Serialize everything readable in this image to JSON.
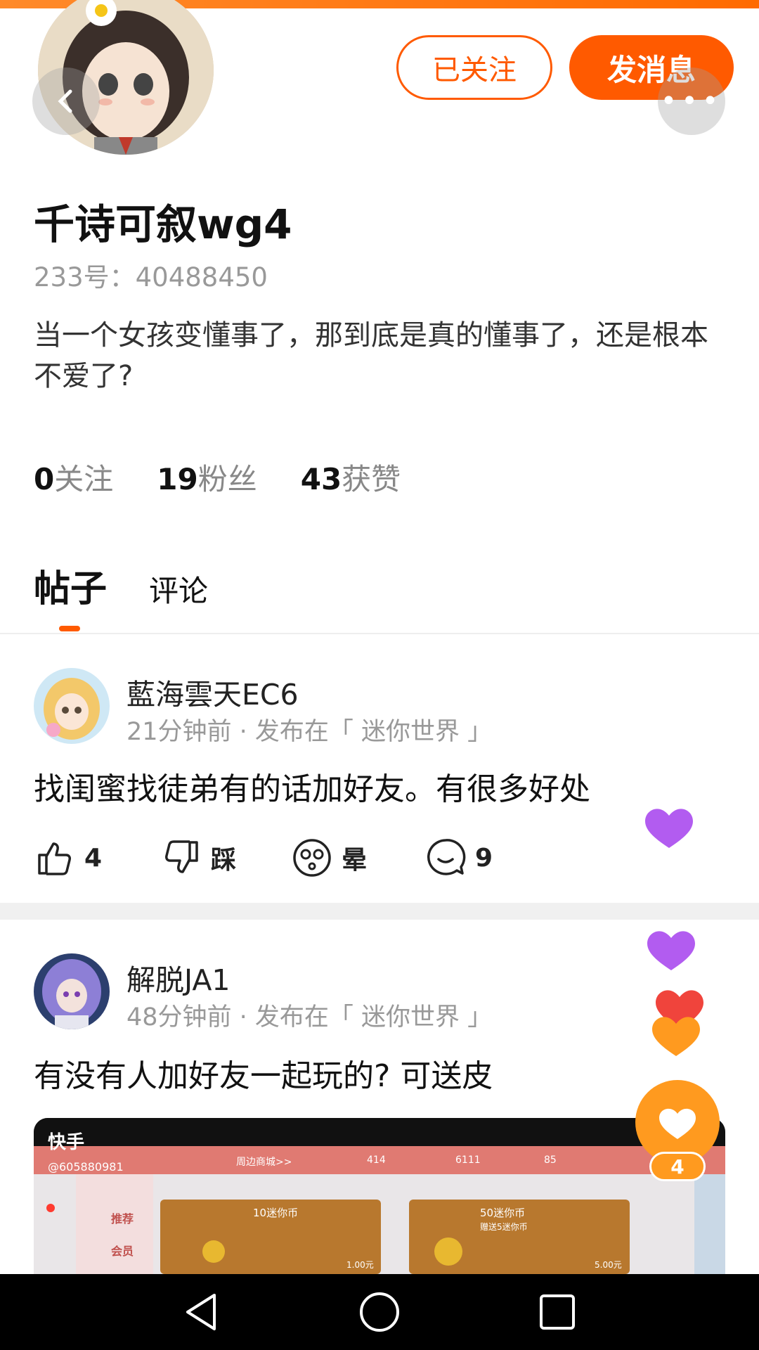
{
  "profile": {
    "name": "千诗可叙wg4",
    "id_text": "233号：40488450",
    "bio": "当一个女孩变懂事了，那到底是真的懂事了，还是根本不爱了?",
    "follow_button": "已关注",
    "message_button": "发消息",
    "stats": [
      {
        "num": "0",
        "label": "关注"
      },
      {
        "num": "19",
        "label": "粉丝"
      },
      {
        "num": "43",
        "label": "获赞"
      }
    ]
  },
  "tabs": [
    {
      "label": "帖子",
      "active": true
    },
    {
      "label": "评论",
      "active": false
    }
  ],
  "posts": [
    {
      "author": "藍海雲天EC6",
      "meta": "21分钟前 · 发布在「 迷你世界 」",
      "text": "找闺蜜找徒弟有的话加好友。有很多好处",
      "actions": {
        "like": "4",
        "dislike": "踩",
        "dizzy": "晕",
        "comment": "9"
      }
    },
    {
      "author": "解脱JA1",
      "meta": "48分钟前 · 发布在「 迷你世界 」",
      "text": "有没有人加好友一起玩的? 可送皮"
    }
  ],
  "video_preview": {
    "watermark_app": "快手",
    "watermark_id": "@605880981",
    "menu_items": [
      "推荐",
      "会员"
    ],
    "shop_tab": "周边商城>>",
    "currency": [
      "414",
      "6111",
      "85"
    ],
    "cards": [
      {
        "title": "10迷你币",
        "price": "1.00元"
      },
      {
        "title": "50迷你币",
        "sub": "赠送5迷你币",
        "price": "5.00元"
      }
    ]
  },
  "like_fab": {
    "count": "4"
  },
  "colors": {
    "accent": "#ff5a00",
    "heart_purple": "#b25cf0",
    "heart_orange": "#ff9a1f"
  }
}
